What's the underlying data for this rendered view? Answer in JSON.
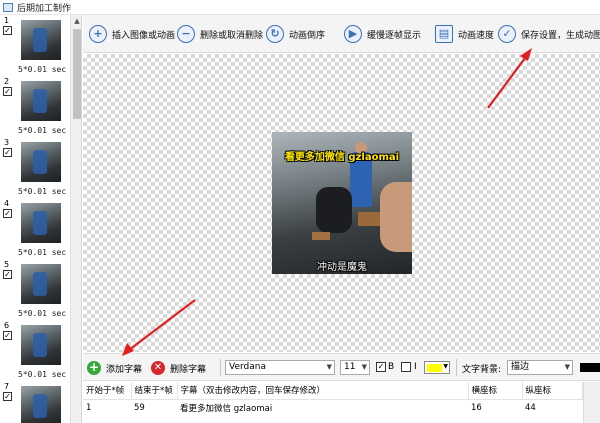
{
  "window": {
    "title": "后期加工制作"
  },
  "frames": [
    {
      "number": "1",
      "checked": true,
      "duration": "5*0.01 sec"
    },
    {
      "number": "2",
      "checked": true,
      "duration": "5*0.01 sec"
    },
    {
      "number": "3",
      "checked": true,
      "duration": "5*0.01 sec"
    },
    {
      "number": "4",
      "checked": true,
      "duration": "5*0.01 sec"
    },
    {
      "number": "5",
      "checked": true,
      "duration": "5*0.01 sec"
    },
    {
      "number": "6",
      "checked": true,
      "duration": "5*0.01 sec"
    },
    {
      "number": "7",
      "checked": true,
      "duration": ""
    }
  ],
  "toolbar": {
    "insert_label": "插入图像或动画",
    "delete_label": "删除或取消删除",
    "reverse_label": "动画倒序",
    "slow_label": "缓慢逐帧显示",
    "speed_label": "动画速度",
    "save_label": "保存设置，生成动图"
  },
  "preview": {
    "caption_top": "看更多加微信 gzlaomai",
    "caption_bottom": "冲动是魔鬼"
  },
  "subtitle_bar": {
    "add_label": "添加字幕",
    "delete_label": "删除字幕",
    "font": "Verdana",
    "size": "11",
    "bold_label": "B",
    "bold_checked": true,
    "italic_label": "I",
    "italic_checked": false,
    "text_color": "#ffff00",
    "bg_label": "文字背景:",
    "bg_mode": "描边",
    "outline_color": "#000000"
  },
  "subtitle_table": {
    "headers": [
      "开始于*帧",
      "结束于*帧",
      "字幕（双击修改内容，回车保存修改）",
      "横座标",
      "纵座标"
    ],
    "rows": [
      [
        "1",
        "59",
        "看更多加微信 gzlaomai",
        "16",
        "44"
      ]
    ]
  }
}
